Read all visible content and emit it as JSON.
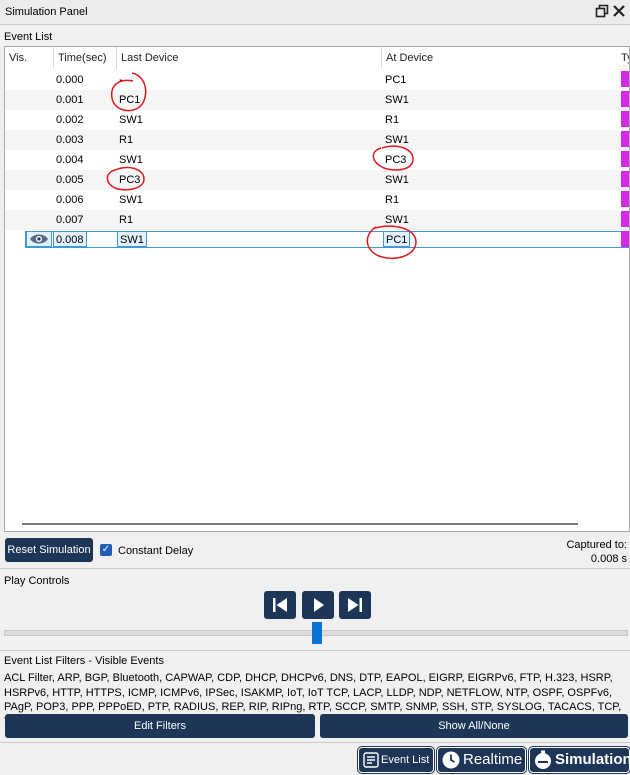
{
  "window": {
    "title": "Simulation Panel",
    "restore_icon": "restore-window-icon",
    "close_icon": "close-icon"
  },
  "event_list": {
    "label": "Event List",
    "columns": [
      "Vis.",
      "Time(sec)",
      "Last Device",
      "At Device",
      "Ty"
    ],
    "rows": [
      {
        "time": "0.000",
        "last": "-",
        "at": "PC1",
        "visible_eye": false,
        "selected": false
      },
      {
        "time": "0.001",
        "last": "PC1",
        "at": "SW1",
        "visible_eye": false,
        "selected": false
      },
      {
        "time": "0.002",
        "last": "SW1",
        "at": "R1",
        "visible_eye": false,
        "selected": false
      },
      {
        "time": "0.003",
        "last": "R1",
        "at": "SW1",
        "visible_eye": false,
        "selected": false
      },
      {
        "time": "0.004",
        "last": "SW1",
        "at": "PC3",
        "visible_eye": false,
        "selected": false
      },
      {
        "time": "0.005",
        "last": "PC3",
        "at": "SW1",
        "visible_eye": false,
        "selected": false
      },
      {
        "time": "0.006",
        "last": "SW1",
        "at": "R1",
        "visible_eye": false,
        "selected": false
      },
      {
        "time": "0.007",
        "last": "R1",
        "at": "SW1",
        "visible_eye": false,
        "selected": false
      },
      {
        "time": "0.008",
        "last": "SW1",
        "at": "PC1",
        "visible_eye": true,
        "selected": true
      }
    ],
    "type_color": "#d329e6"
  },
  "controls": {
    "reset_label": "Reset Simulation",
    "constant_delay_label": "Constant Delay",
    "constant_delay_checked": true,
    "captured_label": "Captured to:",
    "captured_value": "0.008 s"
  },
  "play_controls": {
    "label": "Play Controls",
    "back_icon": "skip-back-icon",
    "play_icon": "play-icon",
    "forward_icon": "skip-forward-icon"
  },
  "filters": {
    "label": "Event List Filters - Visible Events",
    "list": "ACL Filter, ARP, BGP, Bluetooth, CAPWAP, CDP, DHCP, DHCPv6, DNS, DTP, EAPOL, EIGRP, EIGRPv6, FTP, H.323, HSRP, HSRPv6, HTTP, HTTPS, ICMP, ICMPv6, IPSec, ISAKMP, IoT, IoT TCP, LACP, LLDP, NDP, NETFLOW, NTP, OSPF, OSPFv6, PAgP, POP3, PPP, PPPoED, PTP, RADIUS, REP, RIP, RIPng, RTP, SCCP, SMTP, SNMP, SSH, STP, SYSLOG, TACACS, TCP, TFTP, Telnet, UDP, USB, VTP",
    "edit_label": "Edit Filters",
    "show_all_label": "Show All/None"
  },
  "bottom_bar": {
    "event_list_label": "Event List",
    "realtime_label": "Realtime",
    "simulation_label": "Simulation"
  },
  "colors": {
    "accent": "#1d3557",
    "annotation": "#e0191e",
    "selection": "#3d9ad6"
  }
}
